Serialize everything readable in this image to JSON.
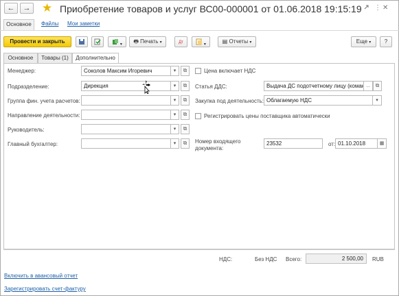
{
  "window": {
    "title": "Приобретение товаров и услуг ВС00-000001 от 01.06.2018 19:15:19",
    "back_icon": "←",
    "forward_icon": "→",
    "star_icon": "★"
  },
  "nav_tabs": [
    "Основное",
    "Файлы",
    "Мои заметки"
  ],
  "toolbar": {
    "post_close": "Провести и закрыть",
    "print": "Печать",
    "reports": "Отчеты",
    "more": "Еще",
    "help": "?"
  },
  "tabs": [
    "Основное",
    "Товары (1)",
    "Дополнительно"
  ],
  "left_form": {
    "manager_label": "Менеджер:",
    "manager_value": "Соколов Максим Игоревич",
    "department_label": "Подразделение:",
    "department_value": "Дирекция",
    "fin_group_label": "Группа фин. учета расчетов:",
    "fin_group_value": "",
    "activity_label": "Направление деятельности:",
    "activity_value": "",
    "head_label": "Руководитель:",
    "head_value": "",
    "accountant_label": "Главный бухгалтер:",
    "accountant_value": ""
  },
  "right_form": {
    "price_includes_vat": "Цена включает НДС",
    "dds_label": "Статья ДДС:",
    "dds_value": "Выдача ДС подотчетному лицу (коман",
    "purchase_label": "Закупка под деятельность:",
    "purchase_value": "Облагаемую НДС",
    "register_prices": "Регистрировать цены поставщика автоматически",
    "incoming_no_label_1": "Номер входящего",
    "incoming_no_label_2": "документа:",
    "incoming_no_value": "23532",
    "date_label": "от:",
    "date_value": "01.10.2018"
  },
  "totals": {
    "vat_label": "НДС:",
    "vat_value": "Без НДС",
    "total_label": "Всего:",
    "total_value": "2 500,00",
    "currency": "RUB"
  },
  "links": {
    "advance_report": "Включить в авансовый отчет",
    "register_invoice": "Зарегистрировать счет-фактуру"
  }
}
